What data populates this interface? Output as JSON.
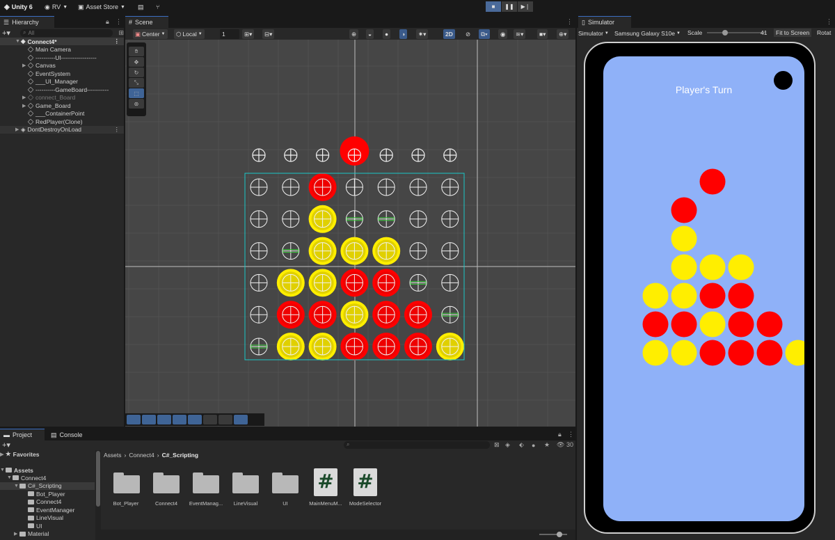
{
  "topbar": {
    "app": "Unity 6",
    "account": "RV",
    "asset_store": "Asset Store"
  },
  "hierarchy": {
    "tab": "Hierarchy",
    "search_placeholder": "All",
    "root": "Connect4*",
    "items": [
      "Main Camera",
      "----------UI------------------",
      "Canvas",
      "EventSystem",
      "___UI_Manager",
      "----------GameBoard-----------",
      "connect_Board",
      "Game_Board",
      "___ContainerPoint",
      "RedPlayer(Clone)"
    ],
    "ddol": "DontDestroyOnLoad"
  },
  "scene": {
    "tab": "Scene",
    "pivot": "Center",
    "space": "Local",
    "snap_value": "1",
    "mode_2d": "2D"
  },
  "simulator": {
    "tab": "Simulator",
    "mode": "Simulator",
    "device": "Samsung Galaxy S10e",
    "scale_label": "Scale",
    "scale_value": "41",
    "fit_button": "Fit to Screen",
    "rotate_button": "Rotat",
    "game_title": "Player's Turn"
  },
  "project": {
    "tab_project": "Project",
    "tab_console": "Console",
    "favorites": "Favorites",
    "assets": "Assets",
    "tree": [
      "Connect4",
      "C#_Scripting",
      "Bot_Player",
      "Connect4",
      "EventManager",
      "LineVisual",
      "UI",
      "Material"
    ],
    "breadcrumb": [
      "Assets",
      "Connect4",
      "C#_Scripting"
    ],
    "hidden_count": "30",
    "files": [
      {
        "name": "Bot_Player",
        "kind": "folder"
      },
      {
        "name": "Connect4",
        "kind": "folder"
      },
      {
        "name": "EventManag...",
        "kind": "folder"
      },
      {
        "name": "LineVisual",
        "kind": "folder"
      },
      {
        "name": "UI",
        "kind": "folder"
      },
      {
        "name": "MainMenuM...",
        "kind": "script"
      },
      {
        "name": "ModeSelector",
        "kind": "script"
      }
    ],
    "script_glyph": "#"
  },
  "colors": {
    "red_piece": "#ff0000",
    "yellow_piece": "#ffee00",
    "phone_screen": "#8fb1f8",
    "selection_outline": "#19c8c8",
    "accent_blue": "#3b6ec4"
  },
  "board": {
    "rows": [
      [
        "E",
        "E",
        "R",
        "E",
        "E",
        "E",
        "E"
      ],
      [
        "E",
        "E",
        "Y",
        "G",
        "G",
        "E",
        "E"
      ],
      [
        "E",
        "G",
        "Y",
        "Y",
        "Y",
        "E",
        "E"
      ],
      [
        "E",
        "Y",
        "Y",
        "R",
        "R",
        "G",
        "E"
      ],
      [
        "E",
        "R",
        "R",
        "Y",
        "R",
        "R",
        "G"
      ],
      [
        "G",
        "Y",
        "Y",
        "R",
        "R",
        "R",
        "Y"
      ]
    ],
    "top_row": [
      "E",
      "E",
      "E",
      "R",
      "E",
      "E",
      "E"
    ]
  },
  "sim_pieces": {
    "rows": [
      [
        "_",
        "_",
        "R",
        "_",
        "_",
        "_"
      ],
      [
        "_",
        "R",
        "_",
        "_",
        "_",
        "_"
      ],
      [
        "_",
        "Y",
        "_",
        "_",
        "_",
        "_"
      ],
      [
        "_",
        "Y",
        "Y",
        "Y",
        "_",
        "_"
      ],
      [
        "Y",
        "Y",
        "R",
        "R",
        "_",
        "_"
      ],
      [
        "R",
        "R",
        "Y",
        "R",
        "R",
        "_"
      ],
      [
        "Y",
        "Y",
        "R",
        "R",
        "R",
        "Y"
      ]
    ]
  }
}
